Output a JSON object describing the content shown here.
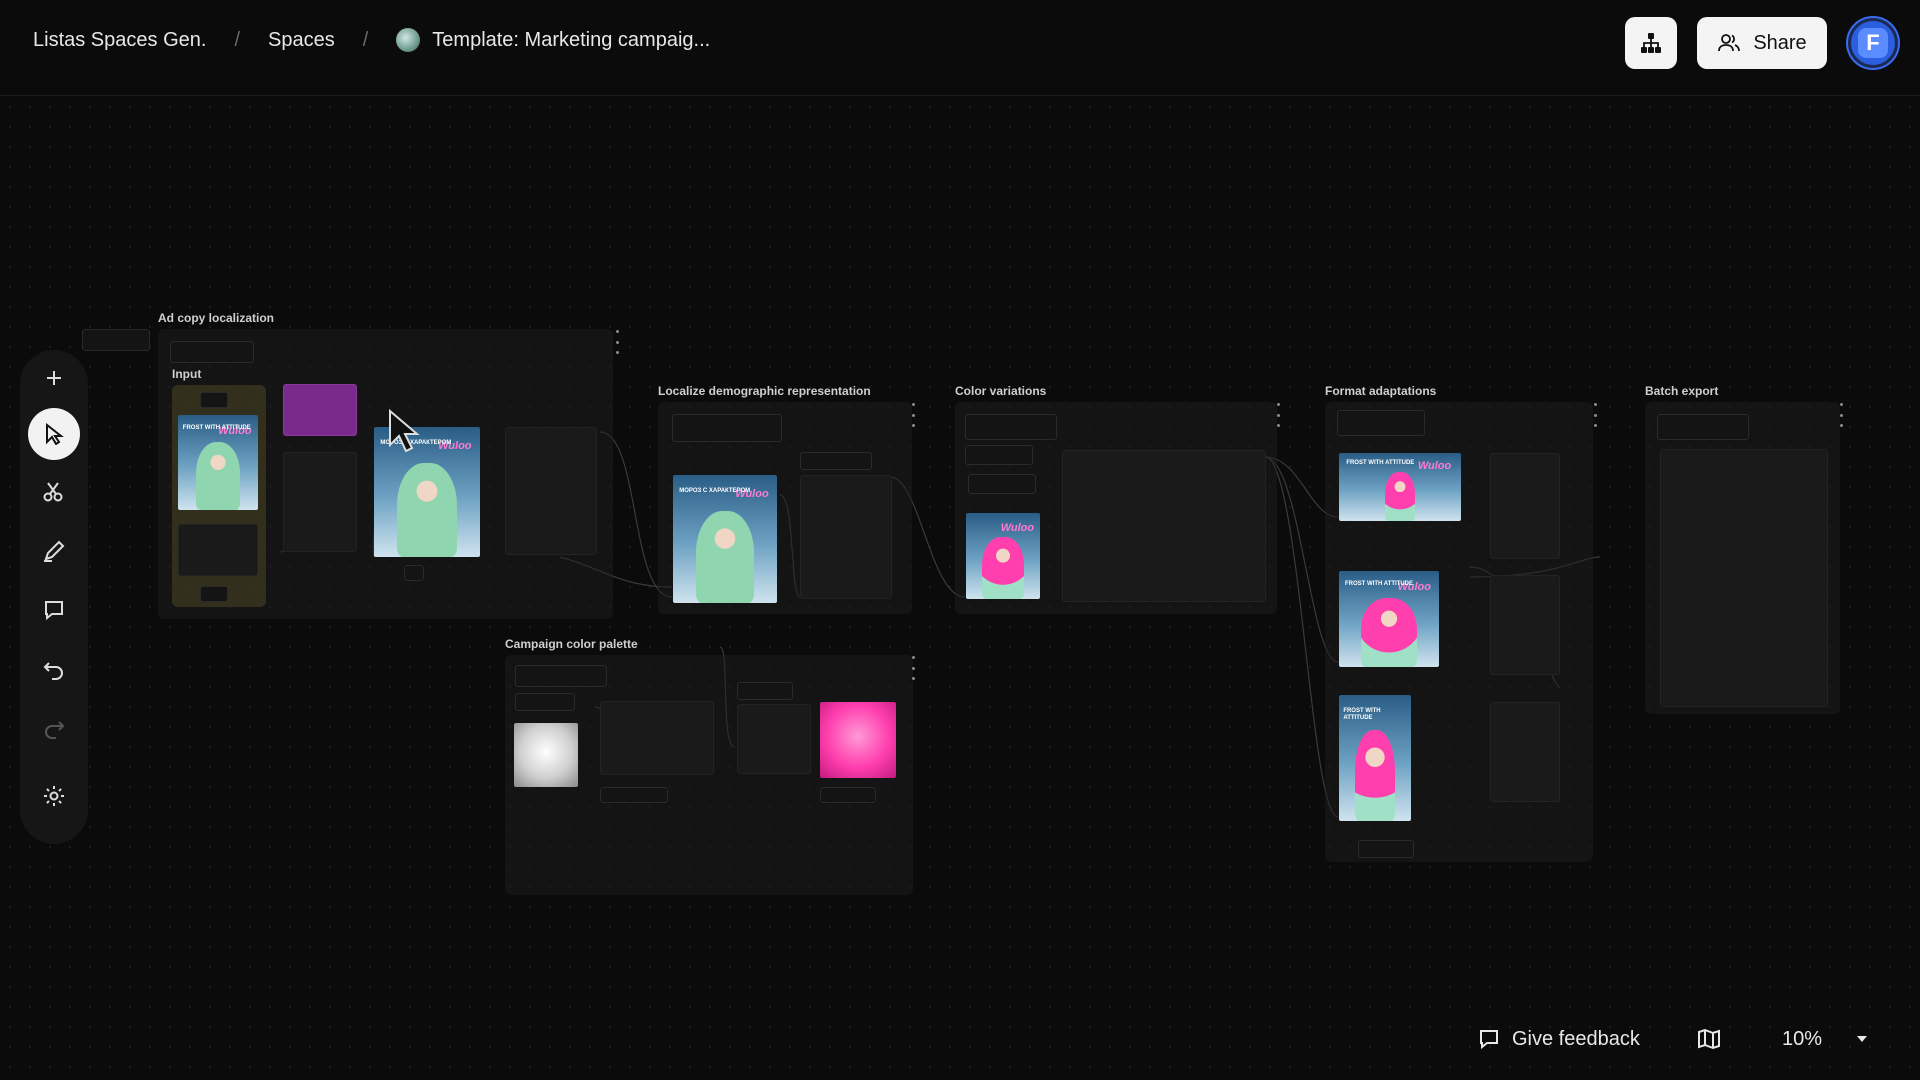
{
  "breadcrumbs": {
    "workspace": "Listas Spaces Gen.",
    "section": "Spaces",
    "separator": "/",
    "current": "Template: Marketing campaig..."
  },
  "header": {
    "share_label": "Share",
    "structure_icon": "sitemap-icon",
    "avatar_letter": "F"
  },
  "toolbar": {
    "items": [
      "add-icon",
      "pointer-icon",
      "scissors-icon",
      "pen-icon",
      "comment-icon",
      "undo-icon",
      "redo-icon",
      "settings-icon"
    ]
  },
  "groups": {
    "ad_copy": "Ad copy localization",
    "input": "Input",
    "localize": "Localize demographic representation",
    "color_variations": "Color variations",
    "format_adaptations": "Format adaptations",
    "batch_export": "Batch export",
    "palette": "Campaign color palette"
  },
  "posters": {
    "logo": "Wuloo",
    "frost_text": "FROST WITH ATTITUDE",
    "moroz_text": "МОРОЗ С ХАРАКТЕРОМ"
  },
  "footer": {
    "feedback_label": "Give feedback",
    "zoom": "10%"
  },
  "colors": {
    "accent_purple": "#7a2a8a",
    "palette_pink": "#ff3fae",
    "palette_white": "#e8e8e8"
  }
}
